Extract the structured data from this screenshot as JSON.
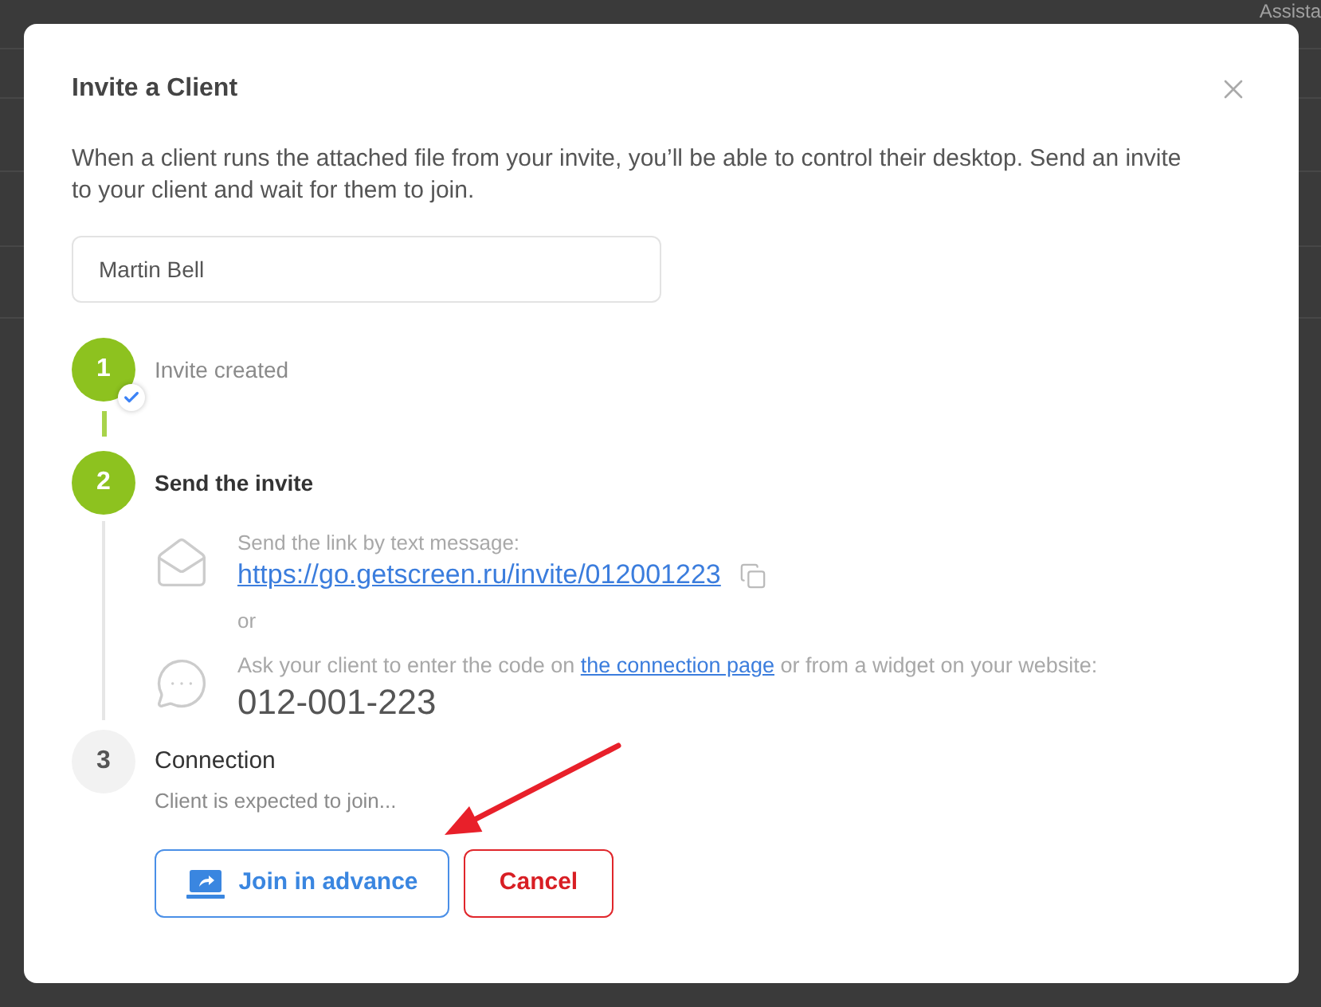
{
  "background": {
    "header_text": "Assista"
  },
  "dialog": {
    "title": "Invite a Client",
    "description": "When a client runs the attached file from your invite, you’ll be able to control their desktop. Send an invite to your client and wait for them to join.",
    "name_field": {
      "value": "Martin Bell"
    }
  },
  "steps": [
    {
      "number": "1",
      "label": "Invite created",
      "completed": true,
      "current": false
    },
    {
      "number": "2",
      "label": "Send the invite",
      "completed": false,
      "current": true,
      "separator": "or",
      "methods": [
        {
          "kind": "link",
          "caption": "Send the link by text message:",
          "value": "https://go.getscreen.ru/invite/012001223"
        },
        {
          "kind": "code",
          "caption_before": "Ask your client to enter the code on",
          "link": "the connection page",
          "caption_after": "or from a widget on your website:",
          "value": "012-001-223"
        }
      ]
    },
    {
      "number": "3",
      "label": "Connection",
      "completed": false,
      "current": false,
      "subtitle": "Client is expected to join..."
    }
  ],
  "buttons": [
    {
      "label": "Join in advance",
      "kind": "primary"
    },
    {
      "label": "Cancel",
      "kind": "danger"
    }
  ]
}
